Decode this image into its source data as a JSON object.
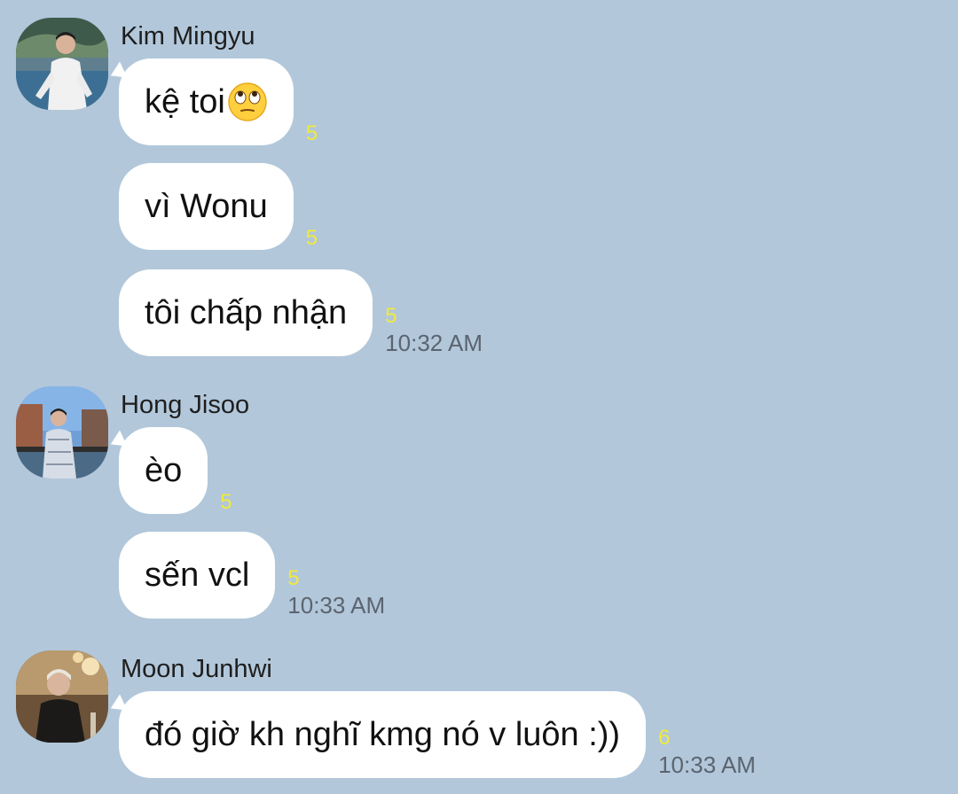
{
  "colors": {
    "background": "#b2c7da",
    "bubble": "#ffffff",
    "read_count": "#f0ea3c",
    "timestamp": "#5b6470"
  },
  "groups": [
    {
      "sender": "Kim Mingyu",
      "messages": [
        {
          "text": "kệ toi",
          "emoji": "face-with-rolling-eyes",
          "read_count": "5",
          "time": ""
        },
        {
          "text": "vì Wonu",
          "read_count": "5",
          "time": ""
        },
        {
          "text": "tôi chấp nhận",
          "read_count": "5",
          "time": "10:32 AM"
        }
      ]
    },
    {
      "sender": "Hong Jisoo",
      "messages": [
        {
          "text": "èo",
          "read_count": "5",
          "time": ""
        },
        {
          "text": "sến vcl",
          "read_count": "5",
          "time": "10:33 AM"
        }
      ]
    },
    {
      "sender": "Moon Junhwi",
      "messages": [
        {
          "text": "đó giờ kh nghĩ kmg nó v luôn :))",
          "read_count": "6",
          "time": "10:33 AM"
        }
      ]
    }
  ]
}
